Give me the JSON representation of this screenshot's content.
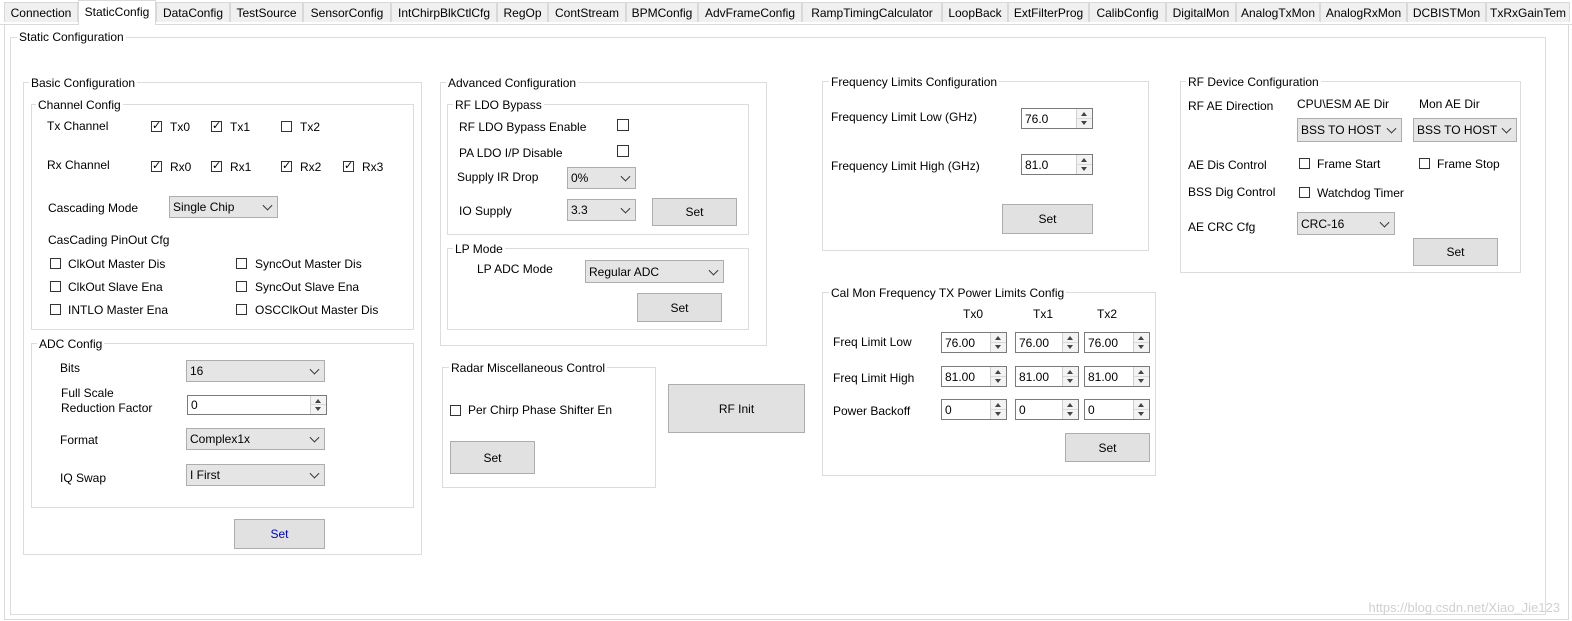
{
  "tabs": [
    "Connection",
    "StaticConfig",
    "DataConfig",
    "TestSource",
    "SensorConfig",
    "IntChirpBlkCtlCfg",
    "RegOp",
    "ContStream",
    "BPMConfig",
    "AdvFrameConfig",
    "RampTimingCalculator",
    "LoopBack",
    "ExtFilterProg",
    "CalibConfig",
    "DigitalMon",
    "AnalogTxMon",
    "AnalogRxMon",
    "DCBISTMon",
    "TxRxGainTem"
  ],
  "active_tab": "StaticConfig",
  "page_title": "Static Configuration",
  "basic": {
    "title": "Basic Configuration",
    "channel": {
      "title": "Channel Config",
      "tx_label": "Tx Channel",
      "tx": [
        {
          "label": "Tx0",
          "checked": true
        },
        {
          "label": "Tx1",
          "checked": true
        },
        {
          "label": "Tx2",
          "checked": false
        }
      ],
      "rx_label": "Rx Channel",
      "rx": [
        {
          "label": "Rx0",
          "checked": true
        },
        {
          "label": "Rx1",
          "checked": true
        },
        {
          "label": "Rx2",
          "checked": true
        },
        {
          "label": "Rx3",
          "checked": true
        }
      ],
      "cascading_label": "Cascading Mode",
      "cascading_value": "Single Chip",
      "pinout_label": "CasCading PinOut Cfg",
      "pinout": [
        {
          "label": "ClkOut Master Dis",
          "checked": false
        },
        {
          "label": "SyncOut Master Dis",
          "checked": false
        },
        {
          "label": "ClkOut Slave Ena",
          "checked": false
        },
        {
          "label": "SyncOut Slave Ena",
          "checked": false
        },
        {
          "label": "INTLO Master Ena",
          "checked": false
        },
        {
          "label": "OSCClkOut Master Dis",
          "checked": false
        }
      ]
    },
    "adc": {
      "title": "ADC Config",
      "bits_label": "Bits",
      "bits_value": "16",
      "fsr_label_1": "Full Scale",
      "fsr_label_2": "Reduction Factor",
      "fsr_value": "0",
      "format_label": "Format",
      "format_value": "Complex1x",
      "iq_label": "IQ Swap",
      "iq_value": "I First"
    },
    "set_label": "Set"
  },
  "advanced": {
    "title": "Advanced Configuration",
    "ldo": {
      "title": "RF LDO Bypass",
      "bypass_label": "RF LDO Bypass Enable",
      "bypass_checked": false,
      "pa_label": "PA LDO I/P Disable",
      "pa_checked": false,
      "ir_label": "Supply IR Drop",
      "ir_value": "0%",
      "io_label": "IO Supply",
      "io_value": "3.3",
      "set_label": "Set"
    },
    "lp": {
      "title": "LP Mode",
      "adc_label": "LP ADC Mode",
      "adc_value": "Regular ADC",
      "set_label": "Set"
    }
  },
  "radar_misc": {
    "title": "Radar Miscellaneous Control",
    "phase_label": "Per Chirp Phase Shifter En",
    "phase_checked": false,
    "set_label": "Set"
  },
  "rf_init_label": "RF Init",
  "freq_limits": {
    "title": "Frequency Limits Configuration",
    "low_label": "Frequency Limit Low (GHz)",
    "low_value": "76.0",
    "high_label": "Frequency Limit High (GHz)",
    "high_value": "81.0",
    "set_label": "Set"
  },
  "calmon": {
    "title": "Cal Mon Frequency TX Power Limits Config",
    "cols": [
      "Tx0",
      "Tx1",
      "Tx2"
    ],
    "rows": [
      {
        "label": "Freq Limit Low",
        "values": [
          "76.00",
          "76.00",
          "76.00"
        ]
      },
      {
        "label": "Freq Limit High",
        "values": [
          "81.00",
          "81.00",
          "81.00"
        ]
      },
      {
        "label": "Power Backoff",
        "values": [
          "0",
          "0",
          "0"
        ]
      }
    ],
    "set_label": "Set"
  },
  "rf_device": {
    "title": "RF Device Configuration",
    "ae_dir_label": "RF AE Direction",
    "cpu_label": "CPU\\ESM AE Dir",
    "cpu_value": "BSS TO HOST",
    "mon_label": "Mon AE Dir",
    "mon_value": "BSS TO HOST",
    "ae_dis_label": "AE Dis Control",
    "frame_start_label": "Frame Start",
    "frame_start_checked": false,
    "frame_stop_label": "Frame Stop",
    "frame_stop_checked": false,
    "bss_label": "BSS Dig Control",
    "watchdog_label": "Watchdog Timer",
    "watchdog_checked": false,
    "crc_label": "AE CRC Cfg",
    "crc_value": "CRC-16",
    "set_label": "Set"
  },
  "watermark": "https://blog.csdn.net/Xiao_Jie123"
}
